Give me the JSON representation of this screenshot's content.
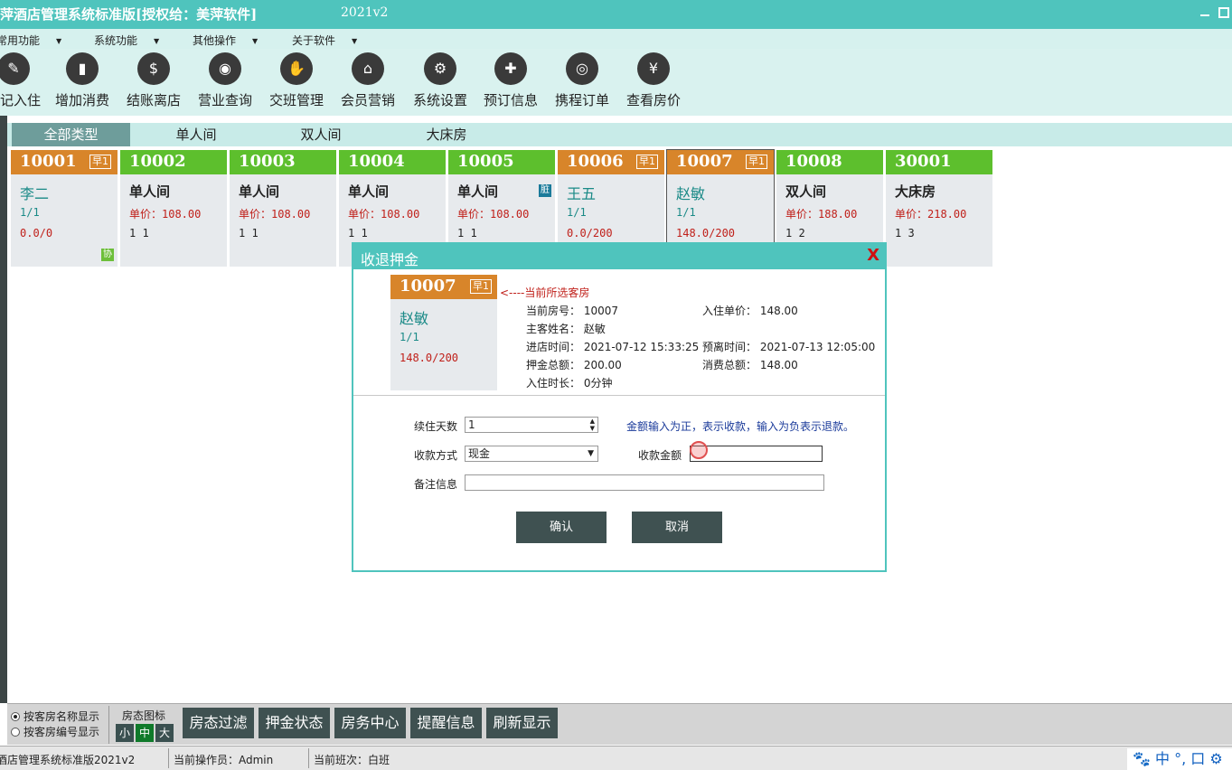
{
  "titlebar": {
    "title": "萍酒店管理系统标准版[授权给：美萍软件]",
    "version": "2021v2"
  },
  "menu": [
    {
      "label": "常用功能"
    },
    {
      "label": "系统功能"
    },
    {
      "label": "其他操作"
    },
    {
      "label": "关于软件"
    }
  ],
  "toolbar": [
    {
      "label": "登记入住",
      "icon": "edit-icon"
    },
    {
      "label": "增加消费",
      "icon": "bottle-icon"
    },
    {
      "label": "结账离店",
      "icon": "receipt-icon"
    },
    {
      "label": "营业查询",
      "icon": "open-sign-icon"
    },
    {
      "label": "交班管理",
      "icon": "hand-money-icon"
    },
    {
      "label": "会员营销",
      "icon": "shop-icon"
    },
    {
      "label": "系统设置",
      "icon": "gear-icon"
    },
    {
      "label": "预订信息",
      "icon": "booking-icon"
    },
    {
      "label": "携程订单",
      "icon": "ctrip-icon"
    },
    {
      "label": "查看房价",
      "icon": "yen-icon"
    }
  ],
  "tabs": [
    {
      "label": "全部类型"
    },
    {
      "label": "单人间"
    },
    {
      "label": "双人间"
    },
    {
      "label": "大床房"
    }
  ],
  "rooms": [
    {
      "num": "10001",
      "tag": "早1",
      "name": "李二",
      "l2": "1/1",
      "l3": "0.0/0",
      "badge": "协",
      "status": "occupied"
    },
    {
      "num": "10002",
      "tag": "",
      "name": "单人间",
      "l2": "单价：108.00",
      "l3": "1 1",
      "badge": "",
      "status": "vacant"
    },
    {
      "num": "10003",
      "tag": "",
      "name": "单人间",
      "l2": "单价：108.00",
      "l3": "1 1",
      "badge": "",
      "status": "vacant"
    },
    {
      "num": "10004",
      "tag": "",
      "name": "单人间",
      "l2": "单价：108.00",
      "l3": "1 1",
      "badge": "",
      "status": "vacant"
    },
    {
      "num": "10005",
      "tag": "",
      "name": "单人间",
      "l2": "单价：108.00",
      "l3": "1 1",
      "badge": "脏",
      "status": "vacant"
    },
    {
      "num": "10006",
      "tag": "早1",
      "name": "王五",
      "l2": "1/1",
      "l3": "0.0/200",
      "badge": "",
      "status": "occupied"
    },
    {
      "num": "10007",
      "tag": "早1",
      "name": "赵敏",
      "l2": "1/1",
      "l3": "148.0/200",
      "badge": "",
      "status": "occupied"
    },
    {
      "num": "10008",
      "tag": "",
      "name": "双人间",
      "l2": "单价：188.00",
      "l3": "1 2",
      "badge": "",
      "status": "vacant"
    },
    {
      "num": "30001",
      "tag": "",
      "name": "大床房",
      "l2": "单价：218.00",
      "l3": "1 3",
      "badge": "",
      "status": "vacant"
    }
  ],
  "dialog": {
    "title": "收退押金",
    "close": "X",
    "room": {
      "num": "10007",
      "tag": "早1",
      "name": "赵敏",
      "l2": "1/1",
      "l3": "148.0/200"
    },
    "hint": "<----当前所选客房",
    "info": {
      "room_no": "当前房号： 10007",
      "price": "入住单价： 148.00",
      "guest": "主客姓名： 赵敏",
      "checkin": "进店时间： 2021-07-12 15:33:25",
      "leave": "预离时间： 2021-07-13 12:05:00",
      "deposit": "押金总额： 200.00",
      "spend": "消费总额： 148.00",
      "duration": "入住时长： 0分钟"
    },
    "form": {
      "days_label": "续住天数",
      "days_value": "1",
      "pay_label": "收款方式",
      "pay_value": "现金",
      "note_label": "备注信息",
      "amount_label": "收款金额",
      "amount_value": "",
      "help": "金额输入为正，表示收款，输入为负表示退款。"
    },
    "confirm": "确认",
    "cancel": "取消"
  },
  "bottom": {
    "radio1": "按客房名称显示",
    "radio2": "按客房编号显示",
    "icon_caption": "房态图标",
    "sizes": [
      "小",
      "中",
      "大"
    ],
    "buttons": [
      "房态过滤",
      "押金状态",
      "房务中心",
      "提醒信息",
      "刷新显示"
    ]
  },
  "status": {
    "app": "酒店管理系统标准版2021v2",
    "operator": "当前操作员：Admin",
    "shift": "当前班次：白班",
    "ime": "中 °, 口 ⚙"
  },
  "colors": {
    "accent": "#4fc4bd",
    "occupied": "#d8852a",
    "vacant": "#5dbf2d",
    "button": "#3f5151"
  }
}
